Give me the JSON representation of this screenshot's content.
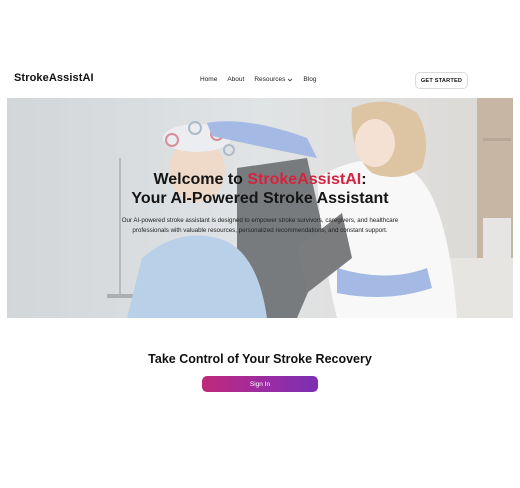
{
  "header": {
    "logo": "StrokeAssistAI",
    "nav": [
      "Home",
      "About",
      "Resources",
      "Blog"
    ],
    "cta": "GET STARTED"
  },
  "hero": {
    "title_prefix": "Welcome to ",
    "title_brand": "StrokeAssistAI",
    "title_suffix": ":",
    "title_line2": "Your AI-Powered Stroke Assistant",
    "description": "Our AI-powered stroke assistant is designed to empower stroke survivors, caregivers, and healthcare professionals with valuable resources, personalized recommendations, and constant support."
  },
  "cta_section": {
    "title": "Take Control of Your Stroke Recovery",
    "button": "Sign In"
  },
  "colors": {
    "brand": "#d3243f",
    "button_gradient_start": "#c0297a",
    "button_gradient_end": "#7b2fb3"
  },
  "icons": [
    "chevron-down-icon"
  ]
}
